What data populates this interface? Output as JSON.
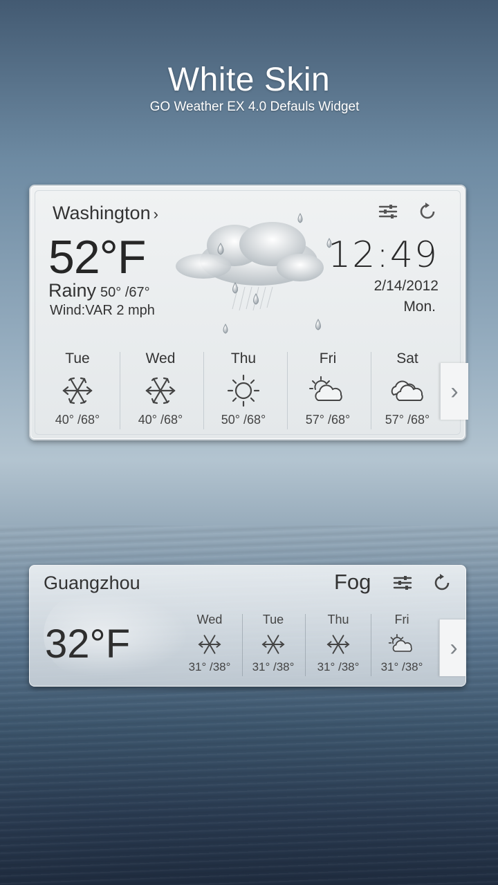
{
  "header": {
    "title": "White Skin",
    "subtitle": "GO Weather EX 4.0 Defauls Widget"
  },
  "widget_main": {
    "city": "Washington",
    "temperature": "52°F",
    "condition": "Rainy",
    "range": "50° /67°",
    "wind": "Wind:VAR 2 mph",
    "time": "12:49",
    "date": "2/14/2012",
    "weekday": "Mon.",
    "forecast": [
      {
        "day": "Tue",
        "icon": "snowflake-icon",
        "temps": "40° /68°"
      },
      {
        "day": "Wed",
        "icon": "snowflake-icon",
        "temps": "40° /68°"
      },
      {
        "day": "Thu",
        "icon": "sun-icon",
        "temps": "50° /68°"
      },
      {
        "day": "Fri",
        "icon": "partly-cloudy-icon",
        "temps": "57° /68°"
      },
      {
        "day": "Sat",
        "icon": "cloudy-icon",
        "temps": "57° /68°"
      }
    ]
  },
  "widget_compact": {
    "city": "Guangzhou",
    "condition": "Fog",
    "temperature": "32°F",
    "forecast": [
      {
        "day": "Wed",
        "icon": "snowflake-icon",
        "temps": "31° /38°"
      },
      {
        "day": "Tue",
        "icon": "snowflake-icon",
        "temps": "31° /38°"
      },
      {
        "day": "Thu",
        "icon": "snowflake-icon",
        "temps": "31° /38°"
      },
      {
        "day": "Fri",
        "icon": "partly-cloudy-icon",
        "temps": "31° /38°"
      }
    ]
  },
  "colors": {
    "text_dark": "#333333",
    "widget_bg": "#eef0f2"
  }
}
